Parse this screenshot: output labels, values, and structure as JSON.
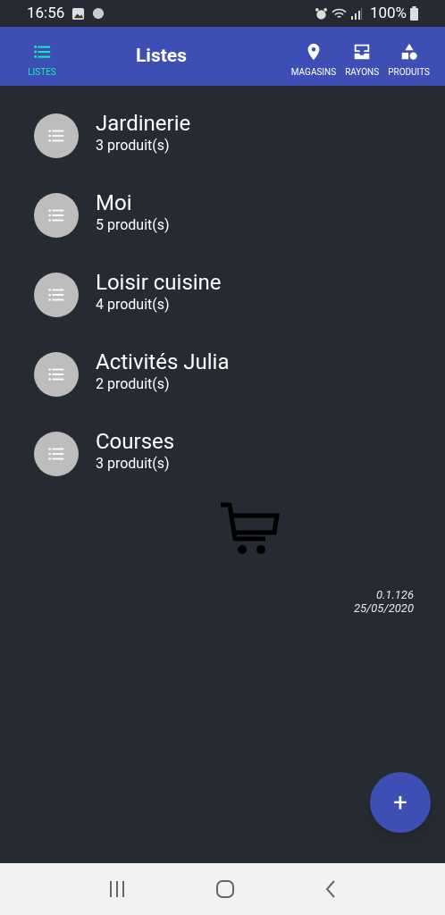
{
  "status_bar": {
    "time": "16:56",
    "battery": "100%"
  },
  "app_bar": {
    "title": "Listes",
    "tabs": [
      {
        "label": "LISTES",
        "kind": "list",
        "selected": true
      },
      {
        "label": "MAGASINS",
        "kind": "pin",
        "selected": false
      },
      {
        "label": "RAYONS",
        "kind": "tray",
        "selected": false
      },
      {
        "label": "PRODUITS",
        "kind": "shapes",
        "selected": false
      }
    ]
  },
  "lists": [
    {
      "name": "Jardinerie",
      "count": "3 produit(s)"
    },
    {
      "name": "Moi",
      "count": "5 produit(s)"
    },
    {
      "name": "Loisir cuisine",
      "count": "4 produit(s)"
    },
    {
      "name": "Activités Julia",
      "count": "2 produit(s)"
    },
    {
      "name": "Courses",
      "count": "3 produit(s)"
    }
  ],
  "version": {
    "number": "0.1.126",
    "date": "25/05/2020"
  },
  "fab": {
    "label": "+"
  }
}
